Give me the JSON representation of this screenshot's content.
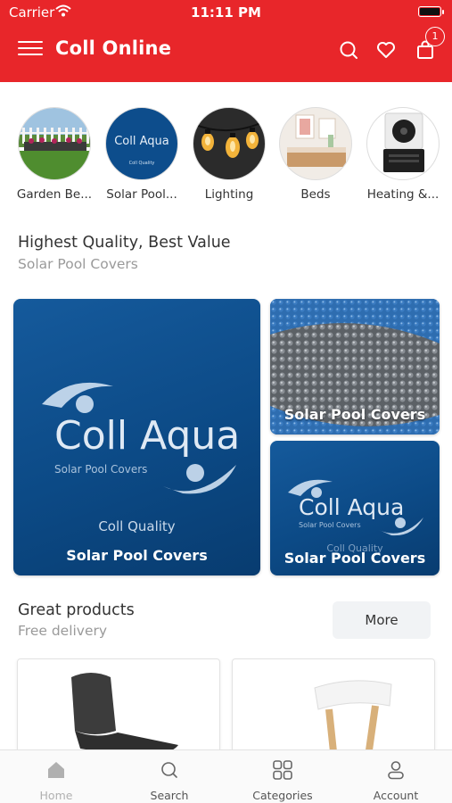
{
  "status_bar": {
    "carrier": "Carrier",
    "time": "11:11 PM"
  },
  "header": {
    "title": "Coll Online",
    "cart_count": "1"
  },
  "categories": [
    {
      "label": "Garden Be..."
    },
    {
      "label": "Solar Pool...",
      "logo_text": "Coll Aqua",
      "logo_sub": "Coll Quality"
    },
    {
      "label": "Lighting"
    },
    {
      "label": "Beds"
    },
    {
      "label": "Heating &..."
    }
  ],
  "section1": {
    "title": "Highest Quality, Best Value",
    "subtitle": "Solar Pool Covers",
    "banners": {
      "main": {
        "logo_text": "Coll Aqua",
        "logo_sub": "Solar Pool Covers",
        "quality": "Coll Quality",
        "label": "Solar Pool Covers"
      },
      "top_right": {
        "label": "Solar Pool Covers"
      },
      "bottom_right": {
        "logo_text": "Coll Aqua",
        "logo_sub": "Solar Pool Covers",
        "quality": "Coll Quality",
        "label": "Solar Pool Covers"
      }
    }
  },
  "section2": {
    "title": "Great products",
    "subtitle": "Free delivery",
    "more_label": "More"
  },
  "tabbar": [
    {
      "label": "Home",
      "icon": "home-icon"
    },
    {
      "label": "Search",
      "icon": "search-icon"
    },
    {
      "label": "Categories",
      "icon": "grid-icon"
    },
    {
      "label": "Account",
      "icon": "user-icon"
    }
  ],
  "colors": {
    "brand_red": "#e8262a",
    "banner_blue": "#0d4d8c",
    "inactive_tab": "#b0b0b0"
  }
}
